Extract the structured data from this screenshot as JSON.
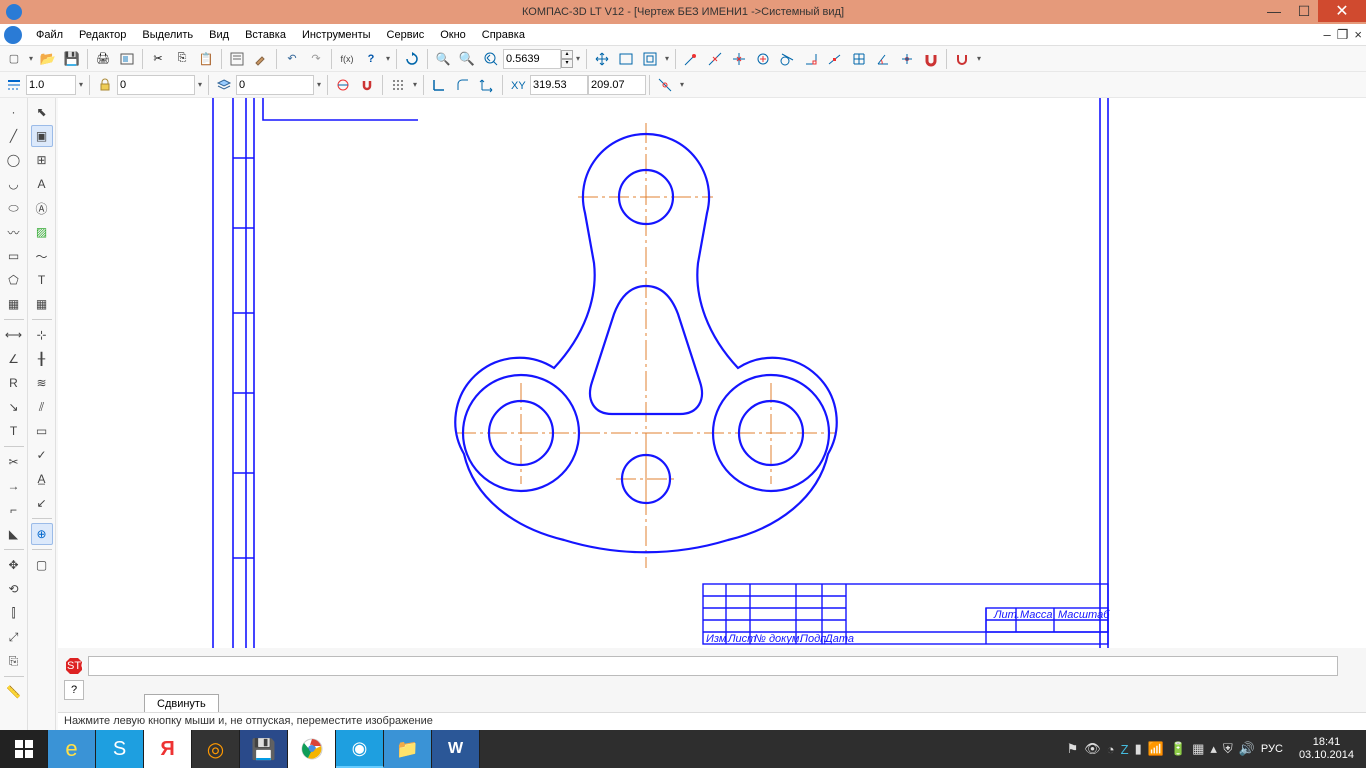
{
  "app": {
    "title": "КОМПАС-3D LT V12 - [Чертеж БЕЗ ИМЕНИ1 ->Системный вид]"
  },
  "menu": {
    "file": "Файл",
    "edit": "Редактор",
    "select": "Выделить",
    "view": "Вид",
    "insert": "Вставка",
    "tools": "Инструменты",
    "service": "Сервис",
    "window": "Окно",
    "help": "Справка"
  },
  "toolbar": {
    "zoom_value": "0.5639",
    "step": "1.0",
    "style": "0",
    "layer": "0",
    "coord_x": "319.53",
    "coord_y": "209.07"
  },
  "command": {
    "tab": "Сдвинуть"
  },
  "status": {
    "hint": "Нажмите левую кнопку мыши и, не отпуская, переместите изображение"
  },
  "taskbar": {
    "lang": "РУС",
    "time": "18:41",
    "date": "03.10.2014"
  },
  "titleblock": {
    "c1": "Изм",
    "c2": "Лист",
    "c3": "№ докум.",
    "c4": "Подп.",
    "c5": "Дата",
    "h1": "Лит.",
    "h2": "Масса",
    "h3": "Масштаб"
  }
}
